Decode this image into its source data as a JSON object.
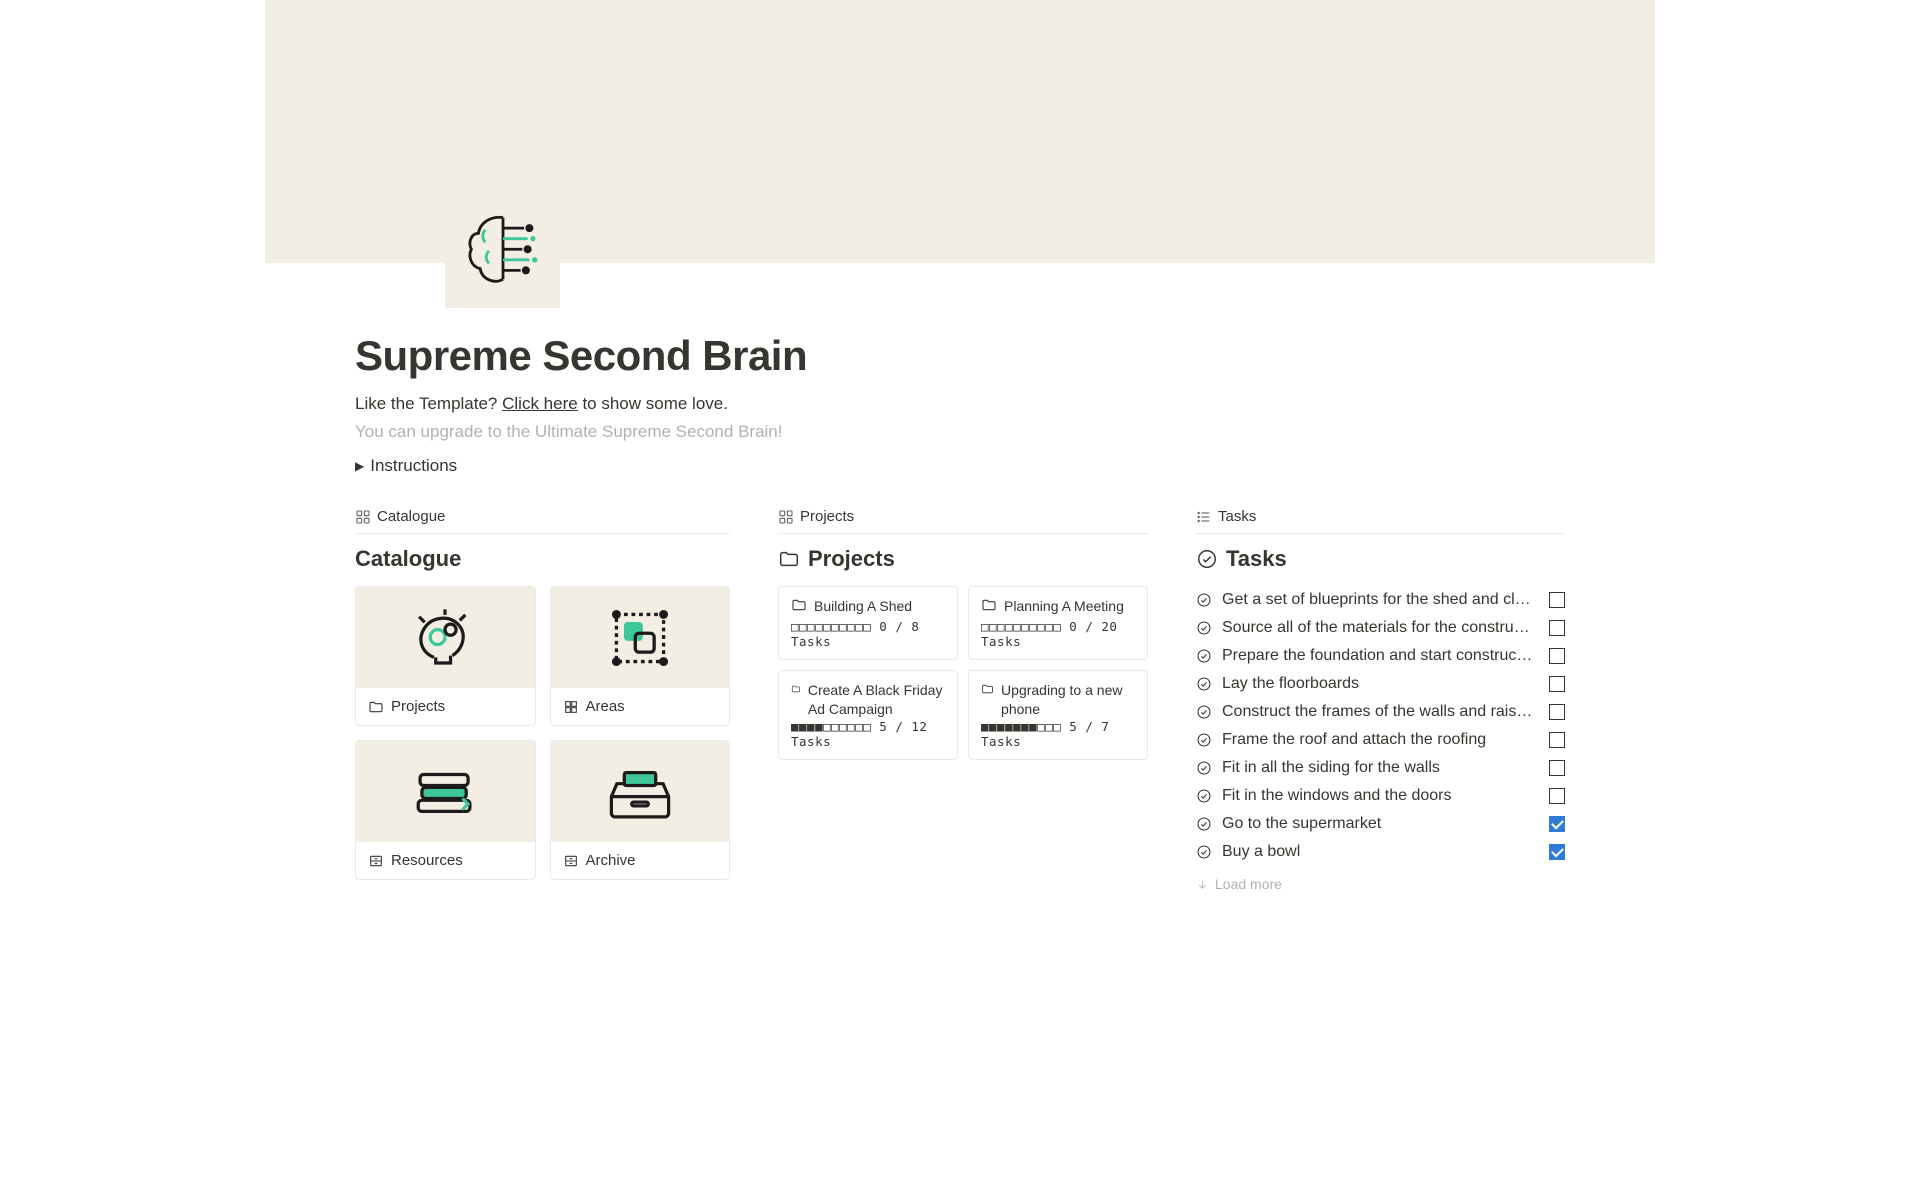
{
  "page": {
    "title": "Supreme Second Brain",
    "subtitle_prefix": "Like the Template? ",
    "subtitle_link": "Click here",
    "subtitle_suffix": " to show some love.",
    "upgrade_text": "You can upgrade to the Ultimate Supreme Second Brain!",
    "instructions_label": "Instructions"
  },
  "catalogue": {
    "tab_label": "Catalogue",
    "heading": "Catalogue",
    "items": [
      {
        "name": "Projects",
        "icon": "folder-icon"
      },
      {
        "name": "Areas",
        "icon": "square-grid-icon"
      },
      {
        "name": "Resources",
        "icon": "cabinet-icon"
      },
      {
        "name": "Archive",
        "icon": "cabinet-icon"
      }
    ]
  },
  "projects": {
    "tab_label": "Projects",
    "heading": "Projects",
    "items": [
      {
        "name": "Building A Shed",
        "progress": "□□□□□□□□□□ 0 / 8 Tasks"
      },
      {
        "name": "Planning A Meeting",
        "progress": "□□□□□□□□□□ 0 / 20 Tasks"
      },
      {
        "name": "Create A Black Friday Ad Campaign",
        "progress": "■■■■□□□□□□ 5 / 12 Tasks"
      },
      {
        "name": "Upgrading to a new phone",
        "progress": "■■■■■■■□□□ 5 / 7 Tasks"
      }
    ]
  },
  "tasks": {
    "tab_label": "Tasks",
    "heading": "Tasks",
    "load_more": "Load more",
    "items": [
      {
        "text": "Get a set of blueprints for the shed and cl…",
        "done": false
      },
      {
        "text": "Source all of the materials for the constru…",
        "done": false
      },
      {
        "text": "Prepare the foundation and start construc…",
        "done": false
      },
      {
        "text": "Lay the floorboards",
        "done": false
      },
      {
        "text": "Construct the frames of the walls and rais…",
        "done": false
      },
      {
        "text": "Frame the roof and attach the roofing",
        "done": false
      },
      {
        "text": "Fit in all the siding for the walls",
        "done": false
      },
      {
        "text": "Fit in the windows and the doors",
        "done": false
      },
      {
        "text": "Go to the supermarket",
        "done": true
      },
      {
        "text": "Buy a bowl",
        "done": true
      }
    ]
  }
}
